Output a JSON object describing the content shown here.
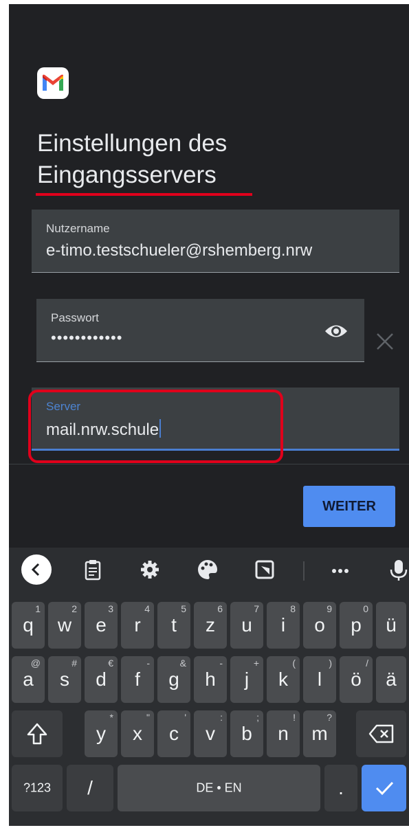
{
  "app": {
    "logo": "gmail-m-logo"
  },
  "header": {
    "title_line1": "Einstellungen des",
    "title_line2": "Eingangsservers"
  },
  "fields": {
    "username": {
      "label": "Nutzername",
      "value": "e-timo.testschueler@rshemberg.nrw"
    },
    "password": {
      "label": "Passwort",
      "value": "••••••••••••"
    },
    "server": {
      "label": "Server",
      "value": "mail.nrw.schule"
    }
  },
  "actions": {
    "next_label": "WEITER"
  },
  "keyboard": {
    "toolbar_icons": [
      "back-arrow-icon",
      "clipboard-icon",
      "gear-icon",
      "palette-icon",
      "resize-icon",
      "more-icon",
      "mic-icon"
    ],
    "row1": [
      {
        "key": "q",
        "hint": "1"
      },
      {
        "key": "w",
        "hint": "2"
      },
      {
        "key": "e",
        "hint": "3"
      },
      {
        "key": "r",
        "hint": "4"
      },
      {
        "key": "t",
        "hint": "5"
      },
      {
        "key": "z",
        "hint": "6"
      },
      {
        "key": "u",
        "hint": "7"
      },
      {
        "key": "i",
        "hint": "8"
      },
      {
        "key": "o",
        "hint": "9"
      },
      {
        "key": "p",
        "hint": "0"
      },
      {
        "key": "ü",
        "hint": ""
      }
    ],
    "row2": [
      {
        "key": "a",
        "hint": "@"
      },
      {
        "key": "s",
        "hint": "#"
      },
      {
        "key": "d",
        "hint": "€"
      },
      {
        "key": "f",
        "hint": "-"
      },
      {
        "key": "g",
        "hint": "&"
      },
      {
        "key": "h",
        "hint": "-"
      },
      {
        "key": "j",
        "hint": "+"
      },
      {
        "key": "k",
        "hint": "("
      },
      {
        "key": "l",
        "hint": ")"
      },
      {
        "key": "ö",
        "hint": "/"
      },
      {
        "key": "ä",
        "hint": ""
      }
    ],
    "row3": [
      {
        "key": "y",
        "hint": "*"
      },
      {
        "key": "x",
        "hint": "\""
      },
      {
        "key": "c",
        "hint": "'"
      },
      {
        "key": "v",
        "hint": ":"
      },
      {
        "key": "b",
        "hint": ";"
      },
      {
        "key": "n",
        "hint": "!"
      },
      {
        "key": "m",
        "hint": "?"
      }
    ],
    "row4": {
      "symbols": "?123",
      "slash": "/",
      "space": "DE • EN",
      "period": "."
    }
  }
}
